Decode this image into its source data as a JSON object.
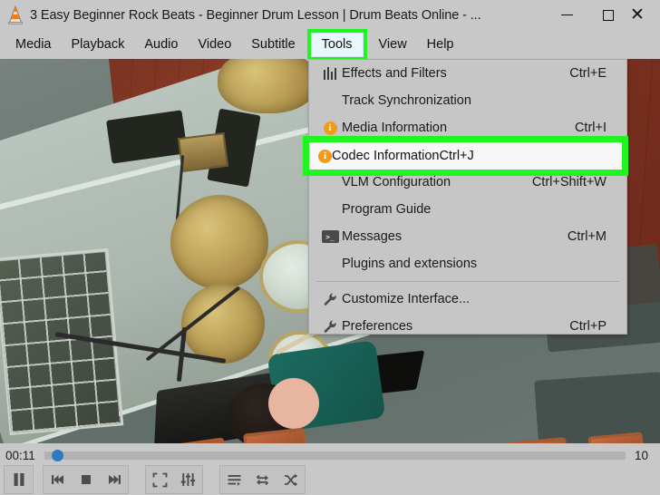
{
  "window": {
    "title": "3 Easy Beginner Rock Beats - Beginner Drum Lesson | Drum Beats Online - ...",
    "app_icon": "vlc-cone-icon",
    "controls": {
      "minimize": "minimize-icon",
      "maximize": "maximize-icon",
      "close": "close-icon"
    }
  },
  "menubar": {
    "items": [
      {
        "label": "Media"
      },
      {
        "label": "Playback"
      },
      {
        "label": "Audio"
      },
      {
        "label": "Video"
      },
      {
        "label": "Subtitle"
      },
      {
        "label": "Tools",
        "active": true,
        "highlight": "#21f521"
      },
      {
        "label": "View"
      },
      {
        "label": "Help"
      }
    ]
  },
  "tools_menu": {
    "items": [
      {
        "label": "Effects and Filters",
        "accel": "Ctrl+E",
        "icon": "equalizer-icon"
      },
      {
        "label": "Track Synchronization",
        "accel": "",
        "icon": ""
      },
      {
        "label": "Media Information",
        "accel": "Ctrl+I",
        "icon": "info-icon"
      },
      {
        "label": "Codec Information",
        "accel": "Ctrl+J",
        "icon": "info-icon",
        "highlighted": true
      },
      {
        "label": "VLM Configuration",
        "accel": "Ctrl+Shift+W",
        "icon": ""
      },
      {
        "label": "Program Guide",
        "accel": "",
        "icon": ""
      },
      {
        "label": "Messages",
        "accel": "Ctrl+M",
        "icon": "terminal-icon"
      },
      {
        "label": "Plugins and extensions",
        "accel": "",
        "icon": ""
      },
      {
        "label": "Customize Interface...",
        "accel": "",
        "icon": "wrench-icon"
      },
      {
        "label": "Preferences",
        "accel": "Ctrl+P",
        "icon": "wrench-icon"
      }
    ]
  },
  "player": {
    "time_elapsed": "00:11",
    "time_total": "10",
    "seek_position_percent": 1,
    "controls": [
      {
        "name": "pause-button",
        "icon": "pause-icon"
      },
      {
        "name": "previous-button",
        "icon": "previous-track-icon"
      },
      {
        "name": "stop-button",
        "icon": "stop-icon"
      },
      {
        "name": "next-button",
        "icon": "next-track-icon"
      },
      {
        "name": "fullscreen-button",
        "icon": "fullscreen-icon"
      },
      {
        "name": "effects-button",
        "icon": "equalizer-icon"
      },
      {
        "name": "playlist-button",
        "icon": "playlist-icon"
      },
      {
        "name": "loop-button",
        "icon": "loop-icon"
      },
      {
        "name": "shuffle-button",
        "icon": "shuffle-icon"
      }
    ]
  },
  "colors": {
    "chrome": "#c8c8c8",
    "menu_bg": "#c6c6c6",
    "highlight_green": "#21f521",
    "highlight_row": "#f7f7f7",
    "accent_blue": "#2b7bc4",
    "info_orange": "#f29c16"
  }
}
